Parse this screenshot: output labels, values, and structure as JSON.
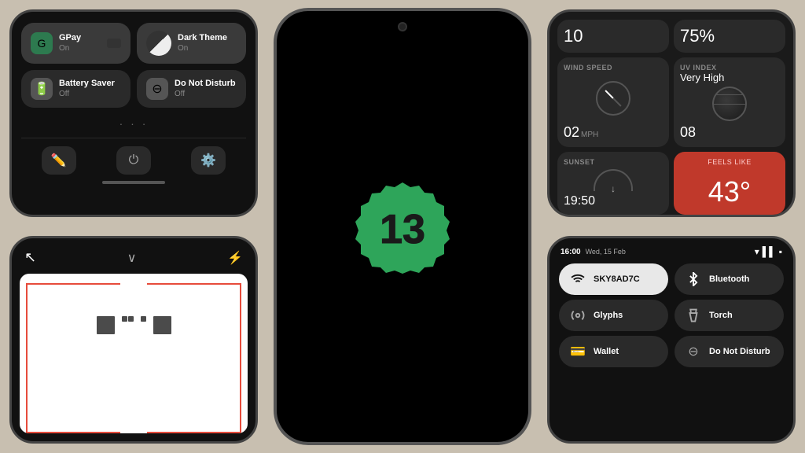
{
  "panel1": {
    "tile1": {
      "label": "GPay",
      "sub": "On"
    },
    "tile2": {
      "label": "Dark Theme",
      "sub": "On"
    },
    "tile3": {
      "label": "Battery Saver",
      "sub": "Off"
    },
    "tile4": {
      "label": "Do Not Disturb",
      "sub": "Off"
    },
    "dots": "• • •"
  },
  "panel2": {
    "logo_number": "13"
  },
  "panel3": {
    "top_left_value": "10",
    "top_right_value": "75%",
    "wind_label": "WIND SPEED",
    "wind_value": "02",
    "wind_unit": "MPH",
    "uv_label": "UV INDEX",
    "uv_sub": "Very High",
    "uv_value": "08",
    "sunset_label": "SUNSET",
    "sunset_time": "19:50",
    "feels_like_label": "FEELS LIKE",
    "feels_like_value": "43°"
  },
  "panel4": {
    "header_icon": "☰"
  },
  "panel5": {
    "time": "16:00",
    "date": "Wed, 15 Feb",
    "tile1_label": "SKY8AD7C",
    "tile2_label": "Bluetooth",
    "tile3_label": "Glyphs",
    "tile4_label": "Torch",
    "tile5_label": "Wallet",
    "tile6_label": "Do Not Disturb"
  }
}
